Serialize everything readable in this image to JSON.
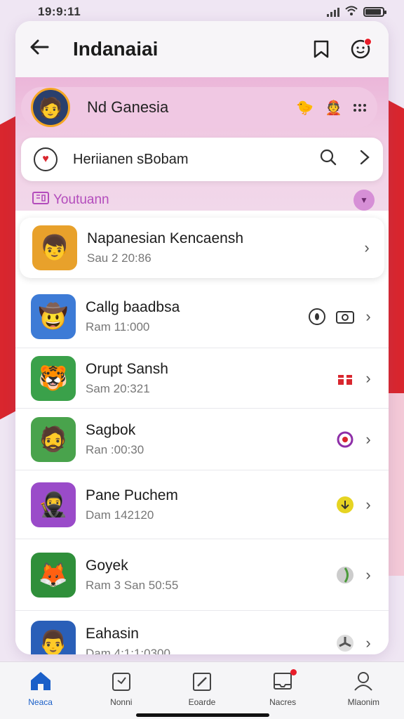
{
  "status": {
    "time": "19:9:11"
  },
  "header": {
    "title": "Indanaiai",
    "back_icon": "arrow-left-icon",
    "bookmark_icon": "bookmark-icon",
    "profile_icon": "smiley-icon"
  },
  "profile": {
    "name": "Nd Ganesia"
  },
  "search": {
    "placeholder": "Heriianen sBobam"
  },
  "section": {
    "label": "Youtuann"
  },
  "items": [
    {
      "title": "Napanesian Kencaensh",
      "subtitle": "Sau 2 20:86",
      "icon_color": "#e8a12b",
      "icon_glyph": "👦",
      "badge": ""
    },
    {
      "title": "Callg baadbsa",
      "subtitle": "Ram 11:000",
      "icon_color": "#3d7bd6",
      "icon_glyph": "🤠",
      "badge": "eye-camera"
    },
    {
      "title": "Orupt Sansh",
      "subtitle": "Sam 20:321",
      "icon_color": "#3aa14a",
      "icon_glyph": "🐯",
      "badge": "gift"
    },
    {
      "title": "Sagbok",
      "subtitle": "Ran :00:30",
      "icon_color": "#49a34c",
      "icon_glyph": "🧔",
      "badge": "target"
    },
    {
      "title": "Pane Puchem",
      "subtitle": "Dam 142120",
      "icon_color": "#9a4bc9",
      "icon_glyph": "🥷",
      "badge": "download"
    },
    {
      "title": "Goyek",
      "subtitle": "Ram 3 San 50:55",
      "icon_color": "#2f8f3a",
      "icon_glyph": "🦊",
      "badge": "globe"
    },
    {
      "title": "Eahasin",
      "subtitle": "Dam 4:1:1:0300",
      "icon_color": "#2a5fb8",
      "icon_glyph": "👨",
      "badge": "fan"
    }
  ],
  "nav": [
    {
      "label": "Neaca",
      "icon": "home-icon",
      "active": true
    },
    {
      "label": "Nonni",
      "icon": "calendar-icon",
      "active": false
    },
    {
      "label": "Eoarde",
      "icon": "edit-icon",
      "active": false
    },
    {
      "label": "Nacres",
      "icon": "inbox-icon",
      "active": false
    },
    {
      "label": "Mlaonim",
      "icon": "person-icon",
      "active": false
    }
  ]
}
